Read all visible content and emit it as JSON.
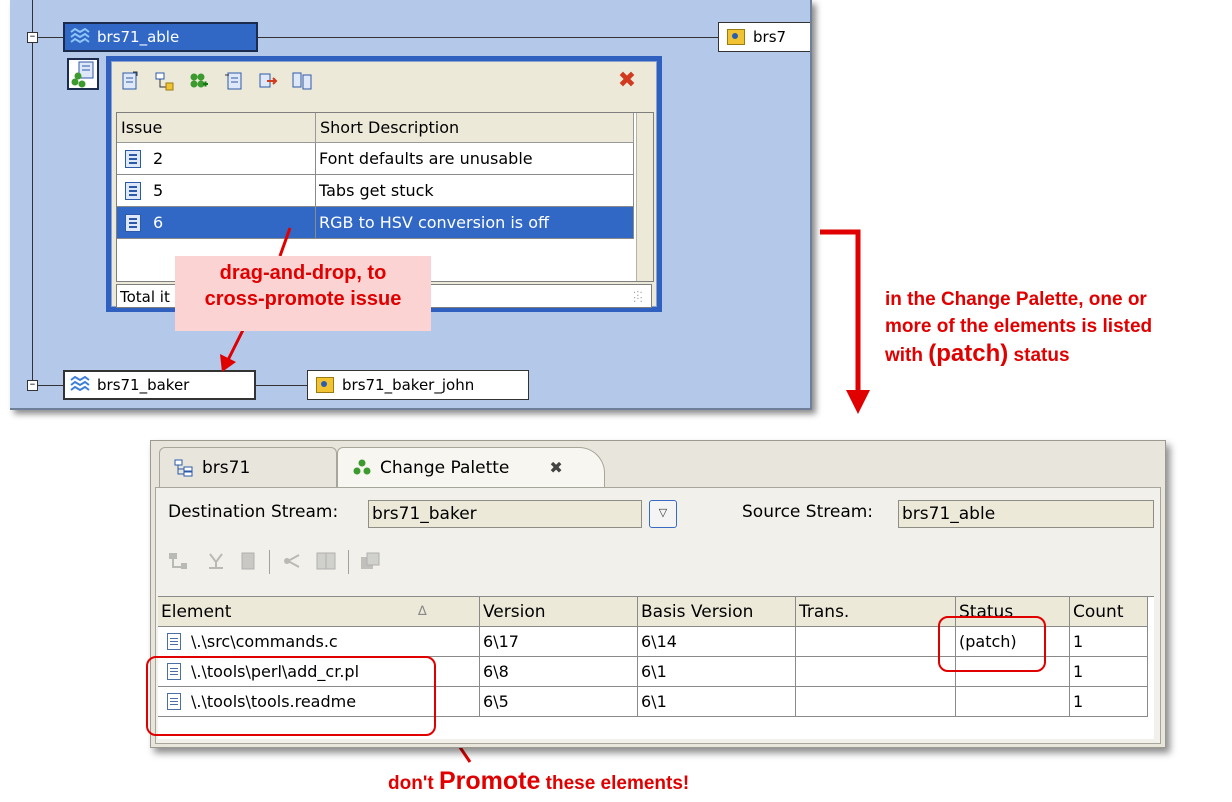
{
  "diagram": {
    "source_stream": "brs71_able",
    "source_workspace": "brs7",
    "dest_stream": "brs71_baker",
    "dest_workspace": "brs71_baker_john",
    "expander_glyph": "−"
  },
  "issue_popup": {
    "columns": [
      "Issue",
      "Short Description"
    ],
    "rows": [
      {
        "issue": "2",
        "desc": "Font defaults are unusable",
        "selected": false
      },
      {
        "issue": "5",
        "desc": "Tabs get stuck",
        "selected": false
      },
      {
        "issue": "6",
        "desc": "RGB to HSV conversion is off",
        "selected": true
      }
    ],
    "total_label": "Total it",
    "close_glyph": "✖",
    "toolbar_icons": [
      "issue-icon",
      "issue-tree-icon",
      "change-palette-icon",
      "issue-detail-icon",
      "send-icon",
      "compare-icon"
    ]
  },
  "annotations": {
    "drag_line1": "drag-and-drop, to",
    "drag_line2": "cross-promote issue",
    "palette_line1": "in the Change Palette, one or",
    "palette_line2": "more of the elements is listed",
    "palette_line3_pre": "with ",
    "palette_line3_code": "(patch)",
    "palette_line3_post": " status",
    "bottom_pre": "don't ",
    "bottom_promote": "Promote",
    "bottom_post": " these elements!"
  },
  "palette": {
    "tabs": [
      {
        "label": "brs71",
        "icon": "stream-tree-icon",
        "active": false
      },
      {
        "label": "Change Palette",
        "icon": "change-palette-icon",
        "active": true,
        "close": "✖"
      }
    ],
    "dest_label": "Destination Stream:",
    "dest_value": "brs71_baker",
    "source_label": "Source Stream:",
    "source_value": "brs71_able",
    "dropdown_glyph": "▽",
    "columns": [
      "Element",
      "Version",
      "Basis Version",
      "Trans.",
      "Status",
      "Count"
    ],
    "sort_glyph": "∆",
    "rows": [
      {
        "element": "\\.\\src\\commands.c",
        "version": "6\\17",
        "basis": "6\\14",
        "trans": "",
        "status": "(patch)",
        "count": "1"
      },
      {
        "element": "\\.\\tools\\perl\\add_cr.pl",
        "version": "6\\8",
        "basis": "6\\1",
        "trans": "",
        "status": "",
        "count": "1"
      },
      {
        "element": "\\.\\tools\\tools.readme",
        "version": "6\\5",
        "basis": "6\\1",
        "trans": "",
        "status": "",
        "count": "1"
      }
    ]
  },
  "colors": {
    "annotation_red": "#e00000",
    "selection_blue": "#3168c6",
    "diagram_bg": "#b4c8ea"
  }
}
